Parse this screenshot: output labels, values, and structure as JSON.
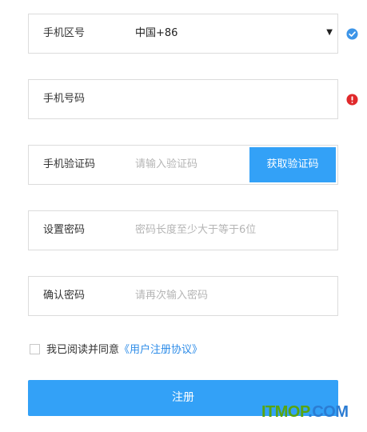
{
  "form": {
    "phone_region": {
      "label": "手机区号",
      "value": "中国+86",
      "status": "valid"
    },
    "phone_number": {
      "label": "手机号码",
      "value": "",
      "placeholder": "",
      "status": "error"
    },
    "sms_code": {
      "label": "手机验证码",
      "placeholder": "请输入验证码",
      "button_label": "获取验证码"
    },
    "password": {
      "label": "设置密码",
      "placeholder": "密码长度至少大于等于6位"
    },
    "confirm_password": {
      "label": "确认密码",
      "placeholder": "请再次输入密码"
    },
    "agreement": {
      "checked": false,
      "text": "我已阅读并同意",
      "link_text": "《用户注册协议》"
    },
    "submit_label": "注册"
  },
  "watermark": {
    "part1": "ITMOP",
    "part2": ".COM"
  },
  "colors": {
    "accent": "#33a1f7",
    "link": "#2d8ce8",
    "valid": "#3d95e8",
    "error": "#e0292b",
    "border": "#dcdcdc",
    "placeholder": "#b5b5b5"
  },
  "icons": {
    "valid": "check-circle-icon",
    "error": "exclamation-circle-icon",
    "dropdown": "caret-down-icon"
  }
}
